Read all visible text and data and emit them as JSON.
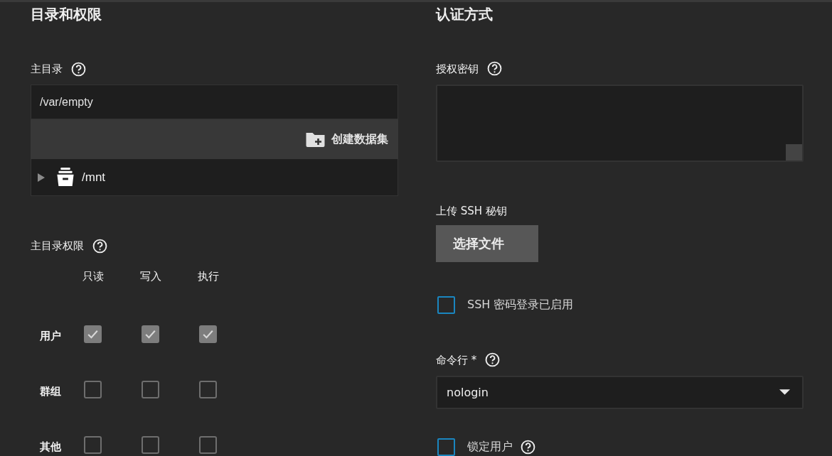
{
  "directories": {
    "title": "目录和权限",
    "home": {
      "label": "主目录",
      "help": true,
      "value": "/var/empty",
      "create_button": "创建数据集",
      "tree": [
        {
          "name": "/mnt",
          "expanded": false
        }
      ]
    },
    "permissions": {
      "label": "主目录权限",
      "help": true,
      "columns": [
        "只读",
        "写入",
        "执行"
      ],
      "rows": [
        {
          "name": "用户",
          "checks": [
            {
              "checked": true
            },
            {
              "checked": true
            },
            {
              "checked": true
            }
          ]
        },
        {
          "name": "群组",
          "checks": [
            {
              "checked": false
            },
            {
              "checked": false
            },
            {
              "checked": false
            }
          ]
        },
        {
          "name": "其他",
          "checks": [
            {
              "checked": false
            },
            {
              "checked": false
            },
            {
              "checked": false
            }
          ]
        }
      ]
    }
  },
  "auth": {
    "title": "认证方式",
    "keys": {
      "label": "授权密钥",
      "help": true
    },
    "upload": {
      "label": "上传 SSH 秘钥",
      "button": "选择文件"
    },
    "ssh_password": {
      "label": "SSH 密码登录已启用",
      "checked": false
    },
    "shell": {
      "label": "命令行 *",
      "help": true,
      "value": "nologin"
    },
    "lock_user": {
      "label": "锁定用户",
      "help": true,
      "checked": false
    }
  }
}
